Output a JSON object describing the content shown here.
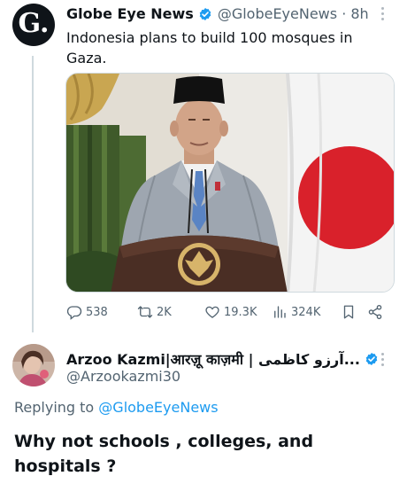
{
  "tweet": {
    "author_name": "Globe Eye News",
    "handle_time": "@GlobeEyeNews · 8h",
    "avatar_letter": "G.",
    "text": "Indonesia plans to build 100 mosques in Gaza.",
    "image_icon": "photo-of-speaker-at-podium",
    "stats": {
      "replies": "538",
      "retweets": "2K",
      "likes": "19.3K",
      "views": "324K"
    }
  },
  "reply": {
    "author_name": "Arzoo Kazmi|आरज़ू काज़मी | آرزو کاظمی...",
    "handle": "@Arzookazmi30",
    "replying_prefix": "Replying to",
    "replying_to": "@GlobeEyeNews",
    "text": "Why not schools , colleges, and hospitals ?"
  },
  "colors": {
    "accent": "#1d9bf0",
    "text": "#0f1419",
    "secondary": "#536471"
  }
}
